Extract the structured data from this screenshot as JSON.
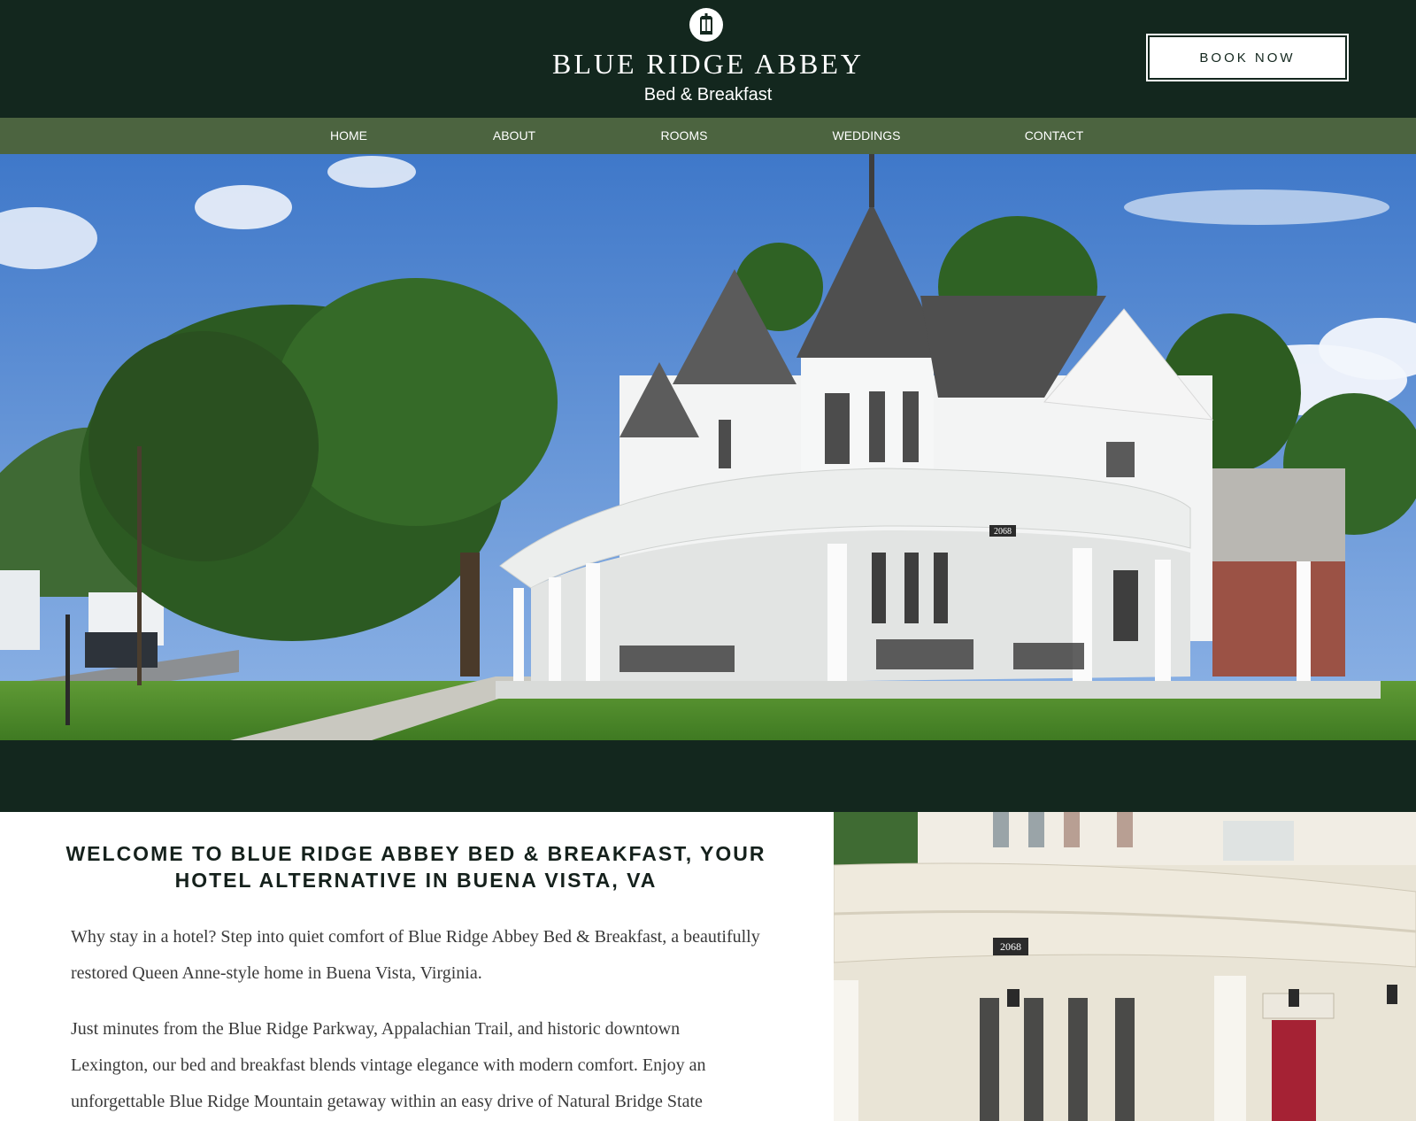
{
  "header": {
    "logo_icon": "lantern-icon",
    "brand_title": "BLUE RIDGE ABBEY",
    "brand_subtitle": "Bed & Breakfast",
    "book_button": "BOOK NOW"
  },
  "nav": {
    "items": [
      {
        "label": "HOME"
      },
      {
        "label": "ABOUT"
      },
      {
        "label": "ROOMS"
      },
      {
        "label": "WEDDINGS"
      },
      {
        "label": "CONTACT"
      }
    ]
  },
  "hero": {
    "house_number": "2068"
  },
  "welcome": {
    "heading": "WELCOME TO BLUE RIDGE ABBEY BED & BREAKFAST, YOUR HOTEL ALTERNATIVE IN BUENA VISTA, VA",
    "paragraph_1": "Why stay in a hotel? Step into quiet comfort of Blue Ridge Abbey Bed & Breakfast, a beautifully restored Queen Anne-style home in Buena Vista, Virginia.",
    "paragraph_2": "Just minutes from the Blue Ridge Parkway, Appalachian Trail, and historic downtown Lexington, our bed and breakfast blends vintage elegance with modern comfort. Enjoy an unforgettable Blue Ridge Mountain getaway within an easy drive of Natural Bridge State"
  },
  "colors": {
    "header_bg": "#13271e",
    "nav_bg": "#4c6440",
    "text_dark": "#15211c"
  }
}
